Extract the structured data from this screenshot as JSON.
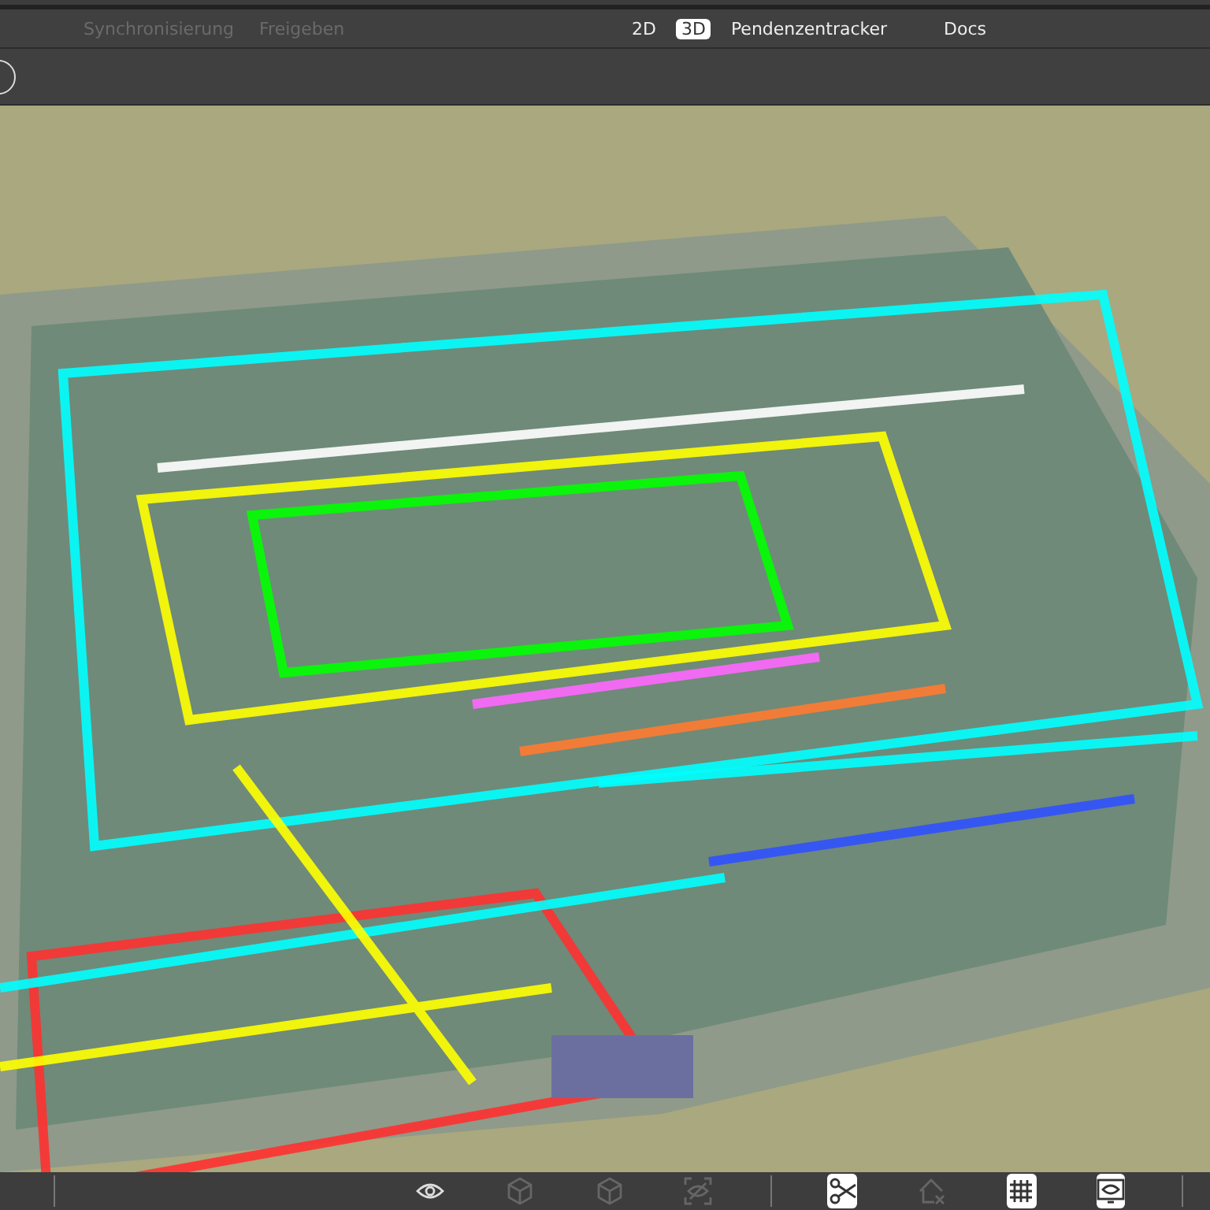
{
  "menu": [
    {
      "label": "Synchronisierung",
      "disabled": true,
      "selected": false
    },
    {
      "label": "Freigeben",
      "disabled": true,
      "selected": false
    }
  ],
  "view_tabs": [
    {
      "label": "2D",
      "selected": false
    },
    {
      "label": "3D",
      "selected": true
    },
    {
      "label": "Pendenzentracker",
      "selected": false
    },
    {
      "label": "Docs",
      "selected": false
    }
  ],
  "tool_groups": [
    [
      {
        "kind": "eye",
        "disabled": false,
        "selected": false
      },
      {
        "kind": "cube",
        "disabled": true,
        "selected": false
      },
      {
        "kind": "cube",
        "disabled": true,
        "selected": false
      },
      {
        "kind": "eye-scan",
        "disabled": true,
        "selected": false
      }
    ],
    [
      {
        "kind": "scissors",
        "disabled": false,
        "selected": true
      },
      {
        "kind": "house-x",
        "disabled": true,
        "selected": false
      },
      {
        "kind": "grid",
        "disabled": false,
        "selected": true
      },
      {
        "kind": "eye-screen",
        "disabled": false,
        "selected": true
      }
    ]
  ]
}
